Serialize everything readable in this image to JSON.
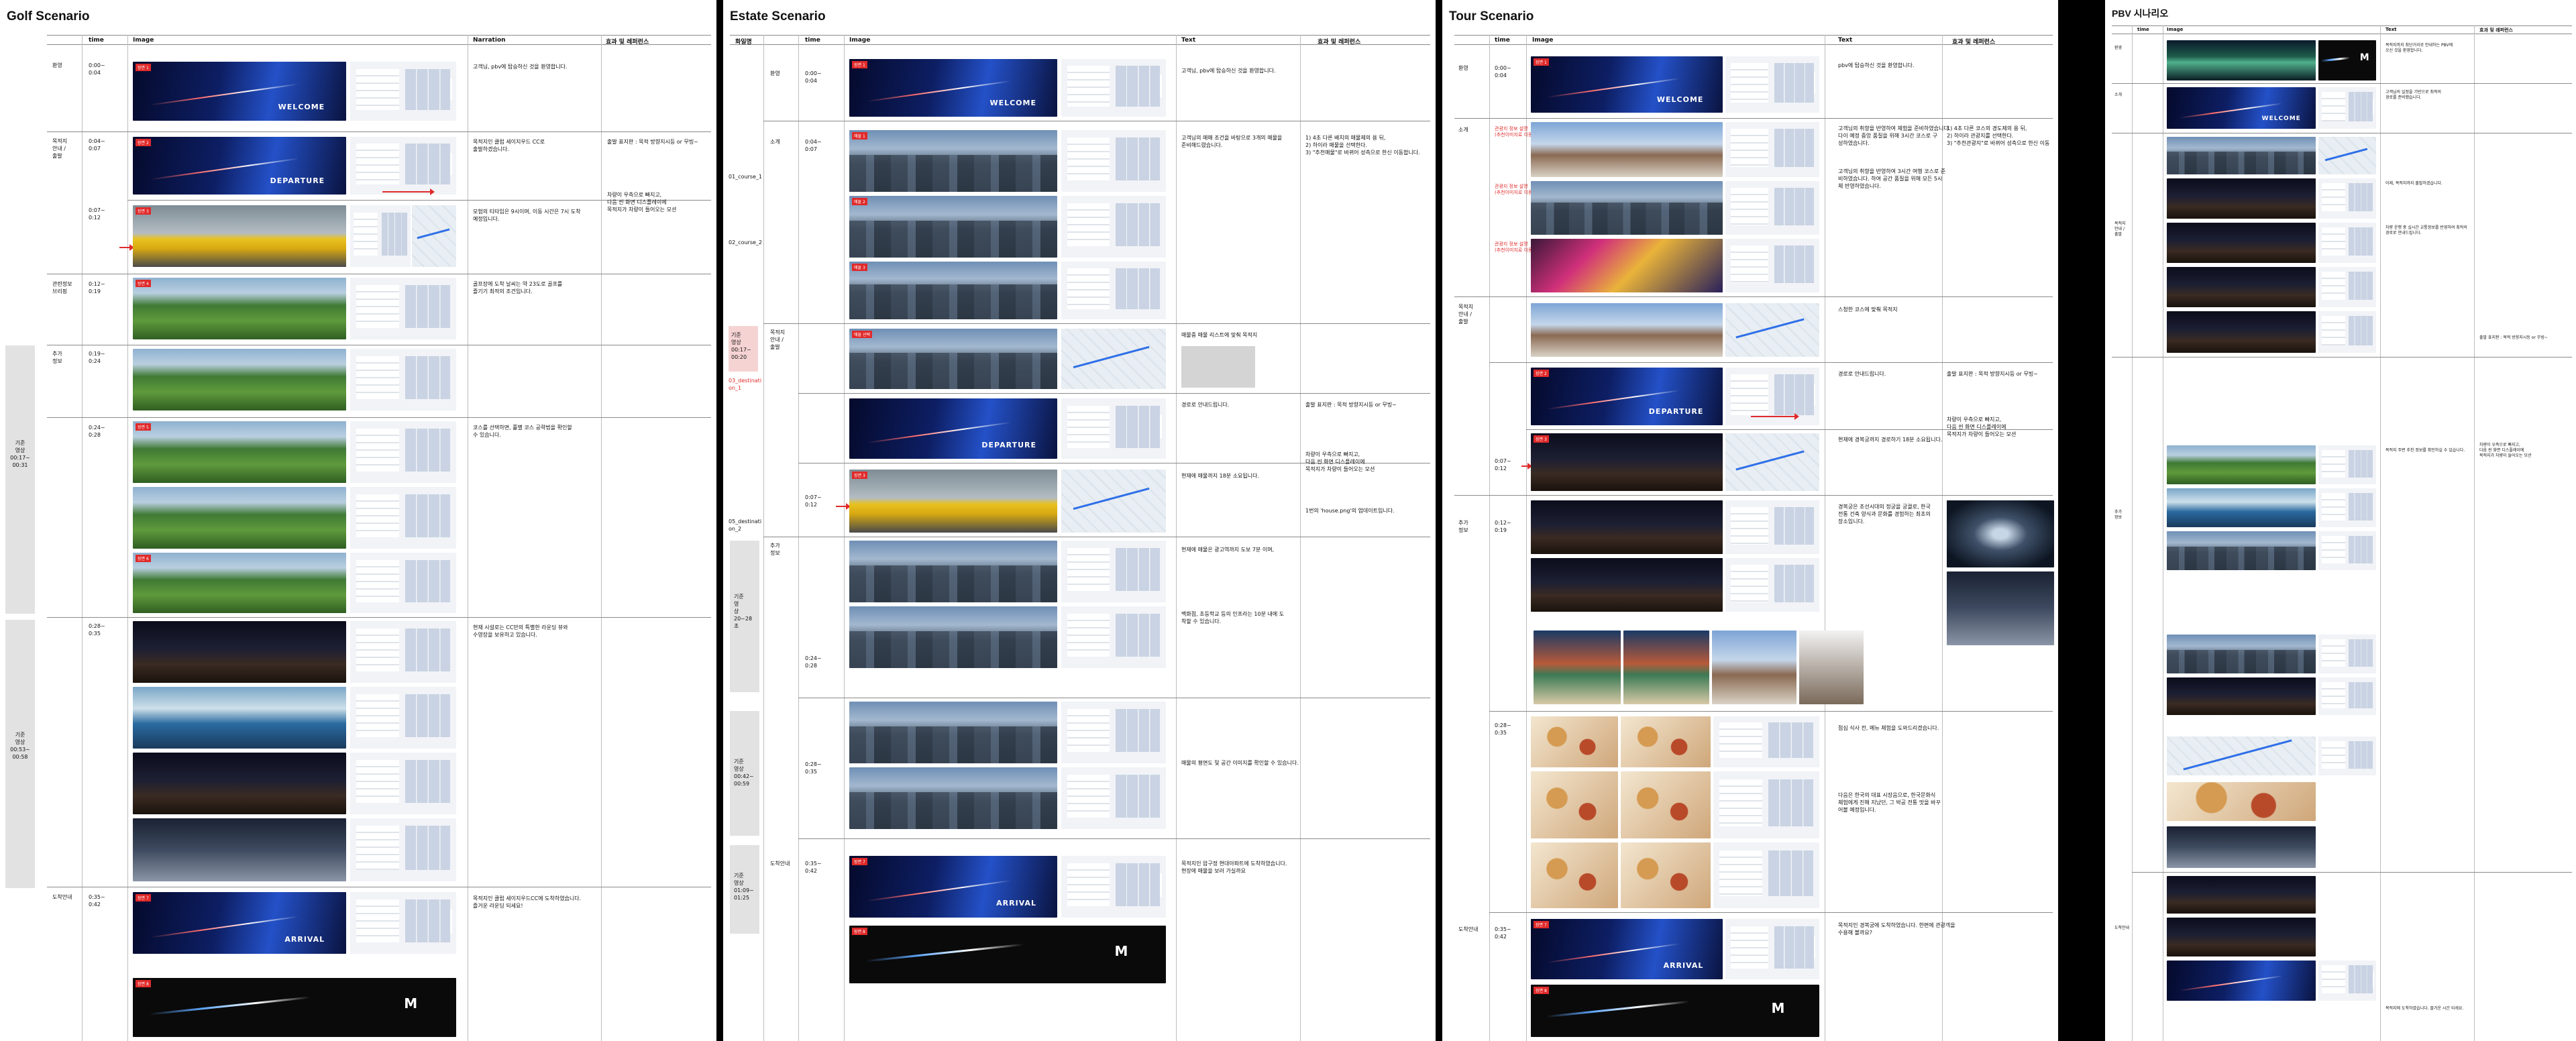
{
  "golf": {
    "title": "Golf Scenario",
    "headers": {
      "time": "time",
      "image": "Image",
      "narration": "Narration",
      "effect": "효과 및 레퍼런스"
    },
    "rows": [
      {
        "section": "환영",
        "time": "0:00~\n0:04",
        "text": "고객님, pbv에 탑승하신 것을 환영합니다."
      },
      {
        "section": "목적지\n안내 /\n출발",
        "time": "0:04~\n0:07",
        "text": "목적지인 클럽 세이지우드 CC로\n출발하겠습니다."
      },
      {
        "section": "",
        "time": "0:07~\n0:12",
        "text": "모험의 티타임은 9시이며, 이동 시간은 7시 도착\n예정입니다."
      },
      {
        "section": "관련정보\n브리핑",
        "time": "0:12~\n0:19",
        "text": "골프장에 도착 날씨는 약 23도로 골프를\n즐기기 최적의 조건입니다."
      },
      {
        "section": "추가\n정보",
        "time": "0:19~\n0:24",
        "text": ""
      },
      {
        "section": "",
        "time": "0:24~\n0:28",
        "text": "코스를 선택하면, 홀별 코스 공략법을 확인할\n수 있습니다."
      },
      {
        "section": "",
        "time": "0:28~\n0:35",
        "text": "현재 시설로는 CC만의 특별한 라운딩 뷰와\n수영장을 보유하고 있습니다."
      },
      {
        "section": "도착안내",
        "time": "0:35~\n0:42",
        "text": "목적지인 클럽 세이지우드CC에 도착하였습니다.\n즐거운 라운딩 되세요!"
      }
    ],
    "effect_notes": [
      "출발 표지판 : 목적 방향지시등 or 무빙~",
      "차량이 우측으로 빠지고,\n다음 씬 화면 디스플레이에\n목적지가 차량이 들어오는 모션"
    ],
    "side_labels": [
      "기준\n영상\n00:17~\n00:31",
      "기준\n영상\n00:53~\n00:58"
    ],
    "cards": {
      "welcome": "WELCOME",
      "departure": "DEPARTURE",
      "arrival": "ARRIVAL"
    }
  },
  "estate": {
    "title": "Estate Scenario",
    "headers": {
      "section": "화일명",
      "time": "time",
      "image": "Image",
      "text": "Text",
      "effect": "효과 및 레퍼런스"
    },
    "rows": [
      {
        "section": "환영",
        "time": "0:00~\n0:04",
        "text": "고객님, pbv에 탑승하신 것을 환영합니다."
      },
      {
        "section": "소개",
        "time": "0:04~\n0:07",
        "text": "고객님의 매매 조건을 바탕으로 3개의 매물을\n준비해드렸습니다."
      },
      {
        "section": "목적지\n안내 /\n출발",
        "time": "",
        "text": "매물중 매물 리스트에 맞춰 목적지"
      },
      {
        "section": "",
        "time": "",
        "text": "경로로 안내드립니다."
      },
      {
        "section": "",
        "time": "0:07~\n0:12",
        "text": "현재에 매물까지 18분 소요됩니다."
      },
      {
        "section": "추가\n정보",
        "time": "",
        "text": "현재에 매물은 광고역까지 도보 7분 이며,"
      },
      {
        "section": "",
        "time": "0:24~\n0:28",
        "text": "백화점, 초등학교 등의 인프라는 10분 내에 도\n착할 수 있습니다."
      },
      {
        "section": "",
        "time": "0:28~\n0:35",
        "text": "매물의 평면도 및 공간 이미지를 확인할 수 있습니다."
      },
      {
        "section": "도착안내",
        "time": "0:35~\n0:42",
        "text": "목적지인 압구정 현대아파트에 도착하였습니다.\n현장에 매물을 보러 가실까요"
      }
    ],
    "file_labels": [
      "01_course_1",
      "02_course_2",
      "03_destinati\non_1",
      "05_destinati\non_2"
    ],
    "effect_notes": [
      "1) 4초 다른 배치의 매물제의 용 뒤,\n2) 하이라 매물을 선택한다.\n3) \"추천매물\"로 바뀌어 성측으로 한신 이동합니다.",
      "출발 표지판 : 목적 방향지시등 or 무빙~",
      "차량이 우측으로 빠지고,\n다음 씬 화면 디스플레이에\n목적지가 차량이 들어오는 모션",
      "1번의 'house.png'의 업데이트입니다."
    ],
    "side_labels": [
      "기준\n영상\n00:17~\n00:20",
      "기준\n영\n상\n20~28\n초",
      "기준\n영상\n00:42~\n00:59",
      "기준\n영상\n01:09~\n01:25"
    ],
    "cards": {
      "welcome": "WELCOME",
      "departure": "DEPARTURE",
      "arrival": "ARRIVAL"
    }
  },
  "tour": {
    "title": "Tour Scenario",
    "headers": {
      "time": "time",
      "image": "Image",
      "text": "Text",
      "effect": "효과 및 레퍼런스"
    },
    "rows": [
      {
        "section": "환영",
        "time": "0:00~\n0:04",
        "text": "pbv에 탑승하신 것을 환영합니다."
      },
      {
        "section": "소개",
        "time": "",
        "text": "고객님의 취향을 반영하여 체험을 준비하였습니다.\n다이 예정 중앙 품질을 위해 3시간 코스로 구\n성하였습니다."
      },
      {
        "section": "",
        "time": "",
        "text": "고객님의 취향을 반영하여 3시간 여행 코스로 준\n비하였습니다. 하여 공간 품질을 위해 모든 5시\n체 반영하였습니다."
      },
      {
        "section": "목적지\n안내 /\n출발",
        "time": "",
        "text": "스청한 코스에 맞춰 목적지"
      },
      {
        "section": "",
        "time": "",
        "text": "경로로 안내드립니다."
      },
      {
        "section": "",
        "time": "0:07~\n0:12",
        "text": "현재에 경복궁까지 경로하기 18분 소요됩니다."
      },
      {
        "section": "추가\n정보",
        "time": "0:12~\n0:19",
        "text": "경복궁은 조선시대의 정궁을 궁궐로, 한국\n전통 건축 양식과 문화를 경험하는 최초의 \n장소입니다."
      },
      {
        "section": "",
        "time": "0:28~\n0:35",
        "text": "점심 식사 전, 메뉴 체험을 도와드리겠습니다."
      },
      {
        "section": "",
        "time": "",
        "text": "다음은 한국의 대표 시장음으로, 한국문화식\n체험에게 진해 지났던, 그 박공 전통 맛을 바꾸\n어볼 예정입니다."
      },
      {
        "section": "도착안내",
        "time": "0:35~\n0:42",
        "text": "목적지인 경복궁에 도착하였습니다. 한편에 관광객을\n수용해 볼까요?"
      }
    ],
    "effect_notes": [
      "1) 4초 다른 코스의 경도제의 용 뒤,\n2) 하이라 관광지를 선택한다.\n3) \"추천관광지\"로 바뀌어 성측으로 한신 이동",
      "출발 표지판 : 목적 방향지시등 or 무빙~",
      "차량이 우측으로 빠지고,\n다음 씬 화면 디스플레이에\n목적지가 차량이 들어오는 모션"
    ],
    "tags": [
      "관광지 정보 설명\n(추천이미지로 이동)",
      "관광지 정보 설명\n(추천이미지로 이동)",
      "관광지 정보 설명\n(추천이미지로 이동)"
    ],
    "cards": {
      "welcome": "WELCOME",
      "departure": "DEPARTURE",
      "arrival": "ARRIVAL"
    }
  },
  "pbv": {
    "title": "PBV 시나리오",
    "headers": {
      "time": "time",
      "image": "Image",
      "text": "Text",
      "effect": "효과 및 레퍼런스"
    },
    "rows": [
      {
        "section": "환영",
        "time": "",
        "text": "목적지까지 최단거리로 안내하는 PBV에\n오신 것을 환영합니다."
      },
      {
        "section": "소개",
        "time": "",
        "text": "고객님의 일정을 기반으로 최적의\n경로를 준비했습니다."
      },
      {
        "section": "목적지\n안내 /\n출발",
        "time": "",
        "text": "이제, 목적지까지 출발하겠습니다."
      },
      {
        "section": "",
        "time": "",
        "text": "차량 운행 중 실시간 교통정보를 반영하여 최적의\n경로로 안내드립니다."
      },
      {
        "section": "추가\n정보",
        "time": "",
        "text": "목적지 주변 추천 정보를 확인하실 수 있습니다."
      },
      {
        "section": "도착안내",
        "time": "",
        "text": "목적지에 도착하였습니다. 즐거운 시간 되세요."
      }
    ],
    "effect_notes": [
      "출발 표지판 : 목적 방향지시등 or 무빙~",
      "차량이 우측으로 빠지고,\n다음 씬 화면 디스플레이에\n목적지가 차량이 들어오는 모션"
    ],
    "cards": {
      "welcome": "WELCOME"
    }
  },
  "colors": {
    "accent_red": "#e02a2a",
    "grey_band": "#e2e2e2",
    "pink_band": "#f6d3d3",
    "background": "#000000"
  }
}
